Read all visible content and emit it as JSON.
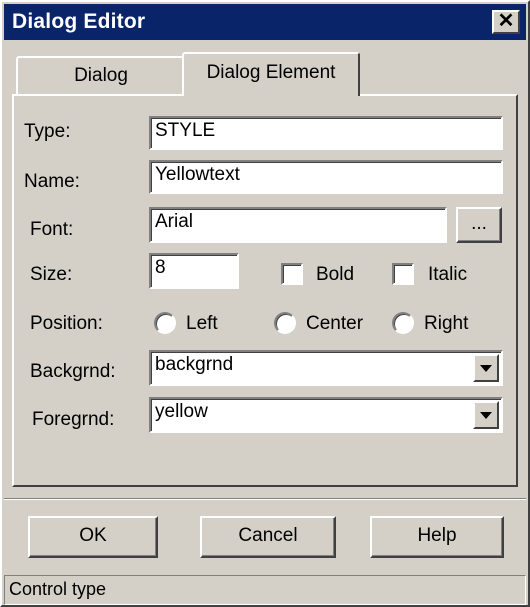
{
  "window": {
    "title": "Dialog Editor",
    "close_glyph": "✕"
  },
  "tabs": [
    {
      "label": "Dialog",
      "active": false
    },
    {
      "label": "Dialog Element",
      "active": true
    }
  ],
  "form": {
    "type_label": "Type:",
    "type_value": "STYLE",
    "name_label": "Name:",
    "name_value": "Yellowtext",
    "font_label": "Font:",
    "font_value": "Arial",
    "font_browse_label": "...",
    "size_label": "Size:",
    "size_value": "8",
    "bold_label": "Bold",
    "bold_checked": false,
    "italic_label": "Italic",
    "italic_checked": false,
    "position_label": "Position:",
    "position_options": [
      "Left",
      "Center",
      "Right"
    ],
    "position_selected": null,
    "backgrnd_label": "Backgrnd:",
    "backgrnd_value": "backgrnd",
    "foregrnd_label": "Foregrnd:",
    "foregrnd_value": "yellow"
  },
  "buttons": {
    "ok": "OK",
    "cancel": "Cancel",
    "help": "Help"
  },
  "status": {
    "text": "Control type"
  },
  "icons": {
    "close": "close-icon",
    "dropdown": "chevron-down-icon"
  }
}
